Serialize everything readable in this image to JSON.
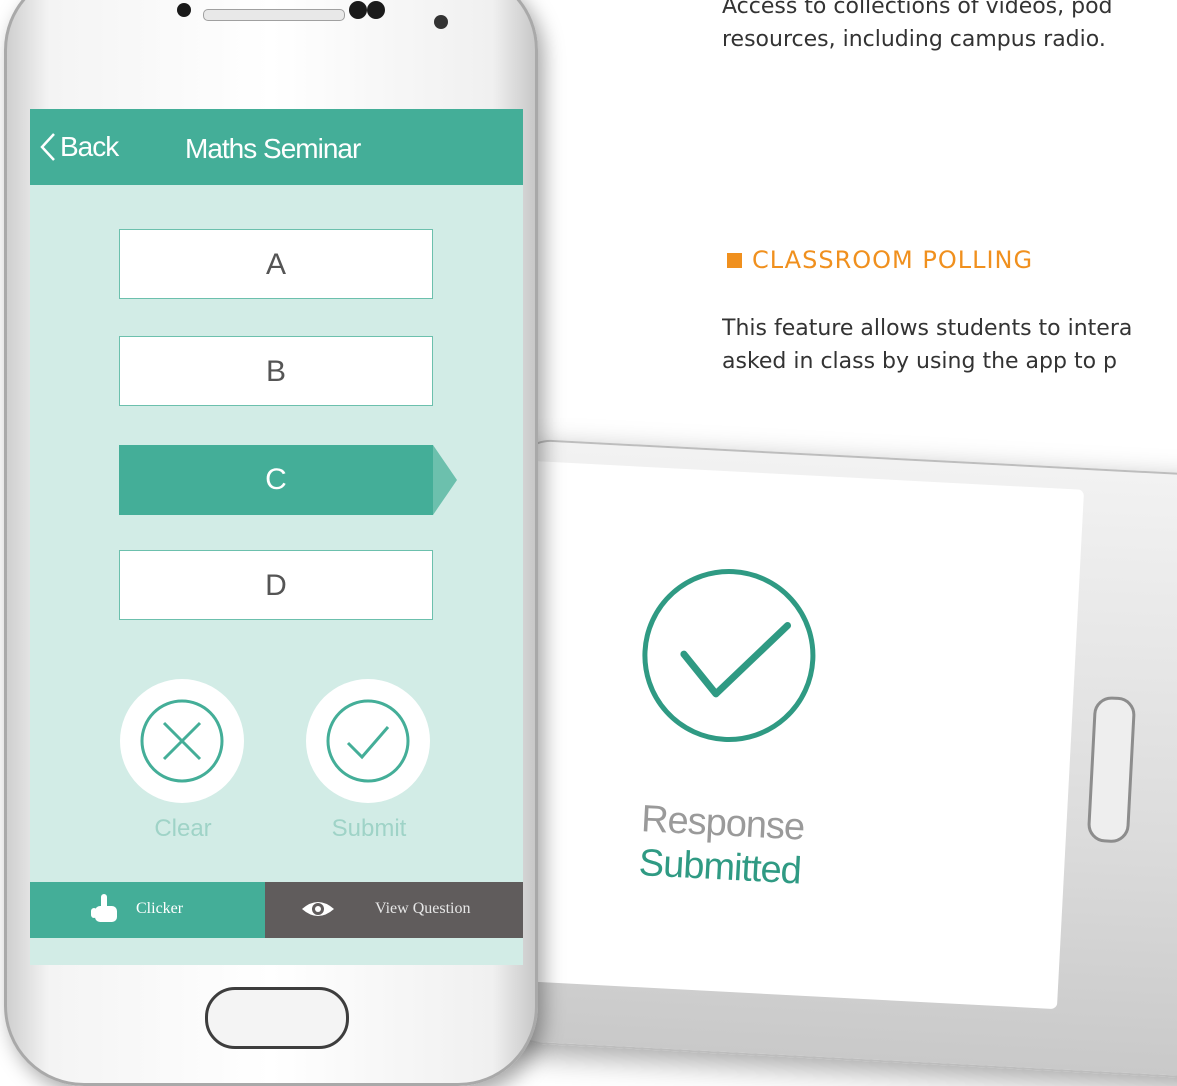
{
  "intro": {
    "line1": "Access to collections of videos, pod",
    "line2": "resources, including campus radio."
  },
  "section": {
    "heading": "CLASSROOM POLLING",
    "body_line1": "This feature allows students to intera",
    "body_line2": "asked in class by using the app to p"
  },
  "app": {
    "back_label": "Back",
    "title": "Maths Seminar",
    "options": [
      {
        "label": "A",
        "selected": false
      },
      {
        "label": "B",
        "selected": false
      },
      {
        "label": "C",
        "selected": true
      },
      {
        "label": "D",
        "selected": false
      }
    ],
    "clear_label": "Clear",
    "submit_label": "Submit",
    "tabs": {
      "clicker": {
        "label": "Clicker",
        "icon": "pointing-hand-icon"
      },
      "view_question": {
        "label": "View Question",
        "icon": "eye-icon"
      }
    }
  },
  "confirmation": {
    "line1": "Response",
    "line2": "Submitted",
    "icon": "check-circle-icon"
  },
  "colors": {
    "accent": "#44ae98",
    "screen_bg": "#d2ece6",
    "heading_orange": "#f0901e",
    "tab_dark": "#605c5c"
  }
}
